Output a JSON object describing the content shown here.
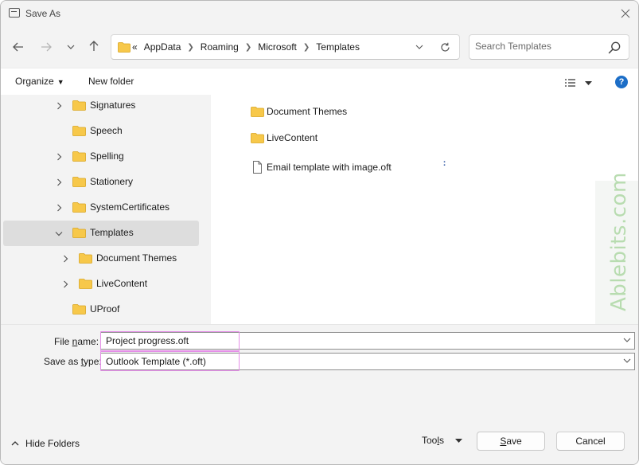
{
  "window": {
    "title": "Save As"
  },
  "nav": {
    "path": [
      "«",
      "AppData",
      "Roaming",
      "Microsoft",
      "Templates"
    ],
    "search_placeholder": "Search Templates"
  },
  "toolbar": {
    "organize_label": "Organize",
    "new_folder_label": "New folder",
    "help_label": "?"
  },
  "tree": {
    "items": [
      {
        "label": "Signatures",
        "expandable": true,
        "expanded": false,
        "level": 1
      },
      {
        "label": "Speech",
        "expandable": false,
        "expanded": false,
        "level": 1
      },
      {
        "label": "Spelling",
        "expandable": true,
        "expanded": false,
        "level": 1
      },
      {
        "label": "Stationery",
        "expandable": true,
        "expanded": false,
        "level": 1
      },
      {
        "label": "SystemCertificates",
        "expandable": true,
        "expanded": false,
        "level": 1
      },
      {
        "label": "Templates",
        "expandable": true,
        "expanded": true,
        "level": 1,
        "selected": true
      },
      {
        "label": "Document Themes",
        "expandable": true,
        "expanded": false,
        "level": 2
      },
      {
        "label": "LiveContent",
        "expandable": true,
        "expanded": false,
        "level": 2
      },
      {
        "label": "UProof",
        "expandable": false,
        "expanded": false,
        "level": 1
      }
    ]
  },
  "files": [
    {
      "label": "Document Themes",
      "icon": "folder-icon"
    },
    {
      "label": "LiveContent",
      "icon": "folder-icon"
    },
    {
      "label": "Email template with image.oft",
      "icon": "file-icon"
    }
  ],
  "watermark": "Ablebits.com",
  "form": {
    "file_name_label": "File name:",
    "file_name_value": "Project progress.oft",
    "save_type_label": "Save as type:",
    "save_type_value": "Outlook Template (*.oft)"
  },
  "footer": {
    "hide_folders_label": "Hide Folders",
    "tools_label": "Tools",
    "save_label": "Save",
    "cancel_label": "Cancel"
  },
  "colors": {
    "accent": "#1c6ec7",
    "highlight": "#e58ee8",
    "folder": "#f7c84a",
    "watermark": "#b8dcb0"
  }
}
